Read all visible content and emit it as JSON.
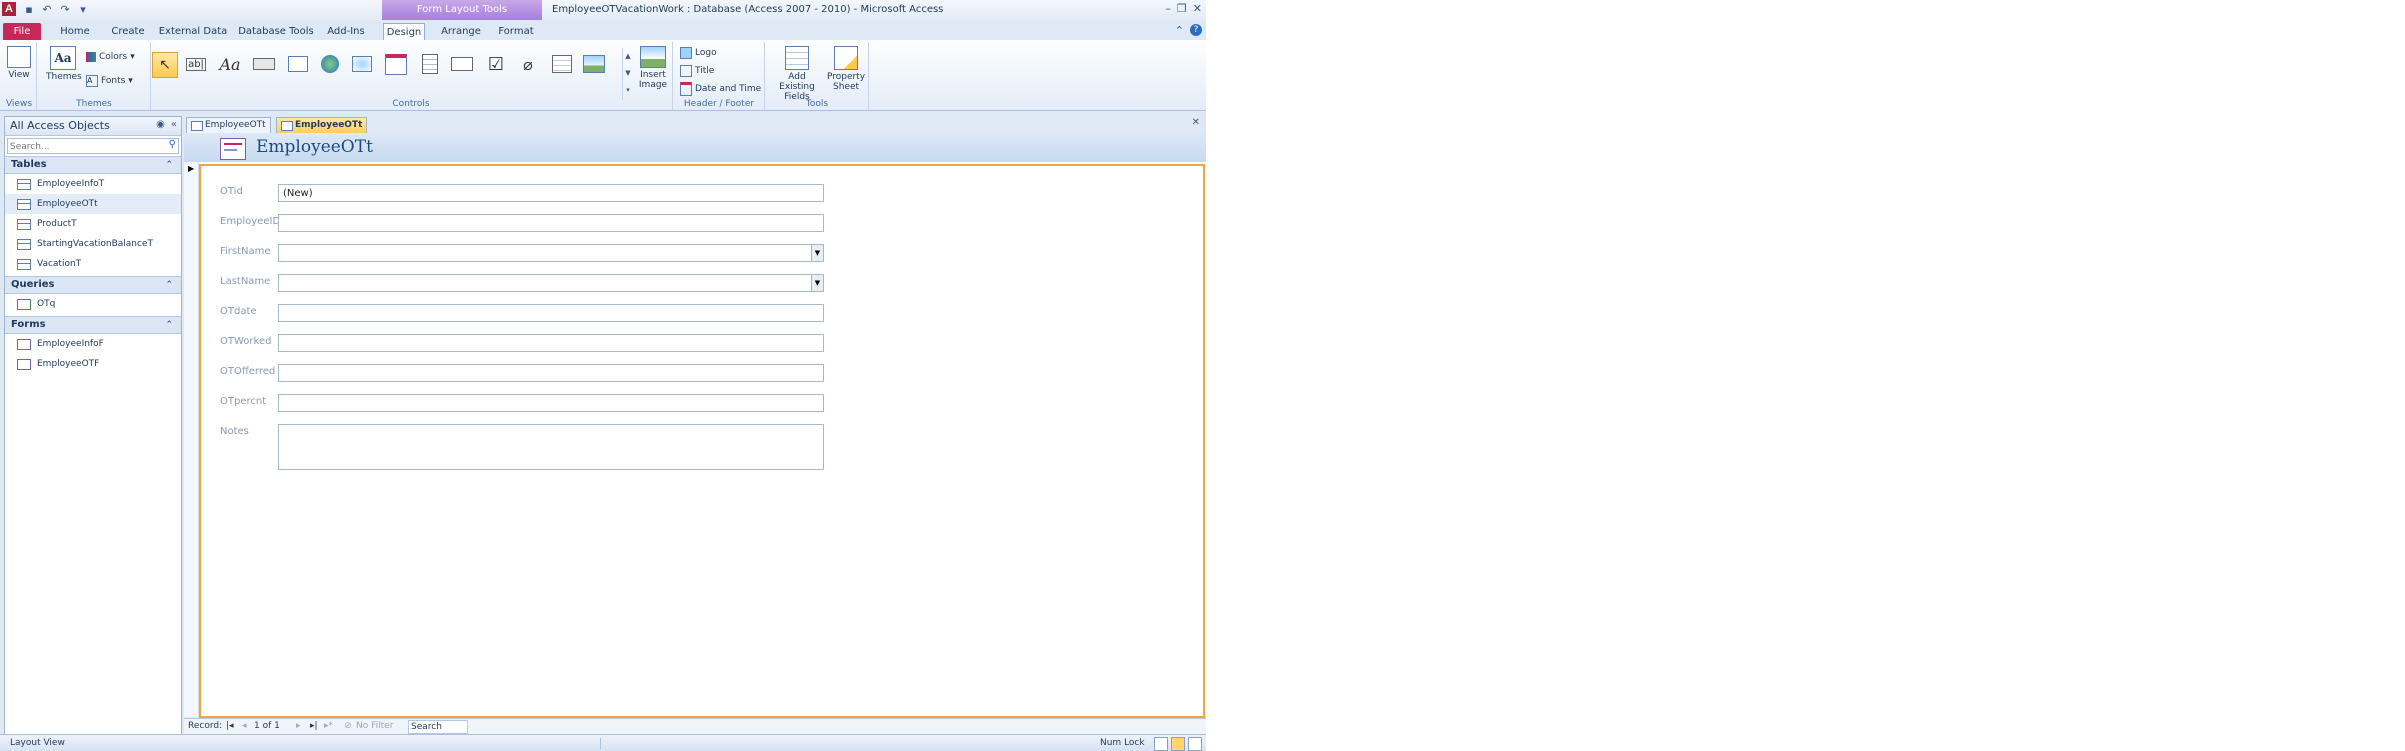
{
  "window": {
    "title": "EmployeeOTVacationWork : Database (Access 2007 - 2010)  -  Microsoft Access",
    "contextual_tab_group": "Form Layout Tools",
    "logo_letter": "A"
  },
  "ribbon_tabs": [
    {
      "label": "File"
    },
    {
      "label": "Home"
    },
    {
      "label": "Create"
    },
    {
      "label": "External Data"
    },
    {
      "label": "Database Tools"
    },
    {
      "label": "Add-Ins"
    },
    {
      "label": "Design"
    },
    {
      "label": "Arrange"
    },
    {
      "label": "Format"
    }
  ],
  "ribbon": {
    "views": {
      "view_label": "View",
      "group_label": "Views"
    },
    "themes": {
      "themes_label": "Themes",
      "colors_label": "Colors",
      "fonts_label": "Fonts",
      "group_label": "Themes"
    },
    "controls": {
      "group_label": "Controls",
      "insert_image_label": "Insert Image"
    },
    "header_footer": {
      "logo_label": "Logo",
      "title_label": "Title",
      "date_time_label": "Date and Time",
      "group_label": "Header / Footer"
    },
    "tools": {
      "add_fields_label": "Add Existing Fields",
      "property_sheet_label": "Property Sheet",
      "group_label": "Tools"
    }
  },
  "nav_pane": {
    "title": "All Access Objects",
    "search_placeholder": "Search...",
    "sections": [
      {
        "label": "Tables",
        "items": [
          "EmployeeInfoT",
          "EmployeeOTt",
          "ProductT",
          "StartingVacationBalanceT",
          "VacationT"
        ]
      },
      {
        "label": "Queries",
        "items": [
          "OTq"
        ]
      },
      {
        "label": "Forms",
        "items": [
          "EmployeeInfoF",
          "EmployeeOTF"
        ]
      }
    ]
  },
  "doc_tabs": [
    {
      "label": "EmployeeOTt"
    },
    {
      "label": "EmployeeOTt"
    }
  ],
  "form": {
    "title": "EmployeeOTt",
    "fields": [
      {
        "label": "OTid",
        "value": "(New)"
      },
      {
        "label": "EmployeeID",
        "value": ""
      },
      {
        "label": "FirstName",
        "value": ""
      },
      {
        "label": "LastName",
        "value": ""
      },
      {
        "label": "OTdate",
        "value": ""
      },
      {
        "label": "OTWorked",
        "value": ""
      },
      {
        "label": "OTOfferred",
        "value": ""
      },
      {
        "label": "OTpercnt",
        "value": ""
      },
      {
        "label": "Notes",
        "value": ""
      }
    ]
  },
  "record_nav": {
    "label": "Record:",
    "position": "1 of 1",
    "filter_label": "No Filter",
    "search_label": "Search"
  },
  "status_bar": {
    "left_text": "Layout View",
    "num_lock": "Num Lock"
  }
}
